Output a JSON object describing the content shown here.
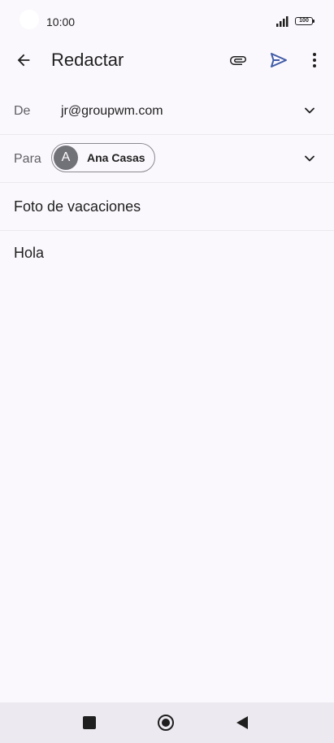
{
  "status_bar": {
    "time": "10:00",
    "battery": "100"
  },
  "app_bar": {
    "title": "Redactar"
  },
  "from_row": {
    "label": "De",
    "value": "jr@groupwm.com"
  },
  "to_row": {
    "label": "Para",
    "recipient_initial": "A",
    "recipient_name": "Ana Casas"
  },
  "subject": "Foto de vacaciones",
  "body": "Hola",
  "colors": {
    "background": "#fbf8fd",
    "send_accent": "#3f5aa6",
    "avatar": "#717178",
    "nav_bar": "#ede9f0"
  }
}
